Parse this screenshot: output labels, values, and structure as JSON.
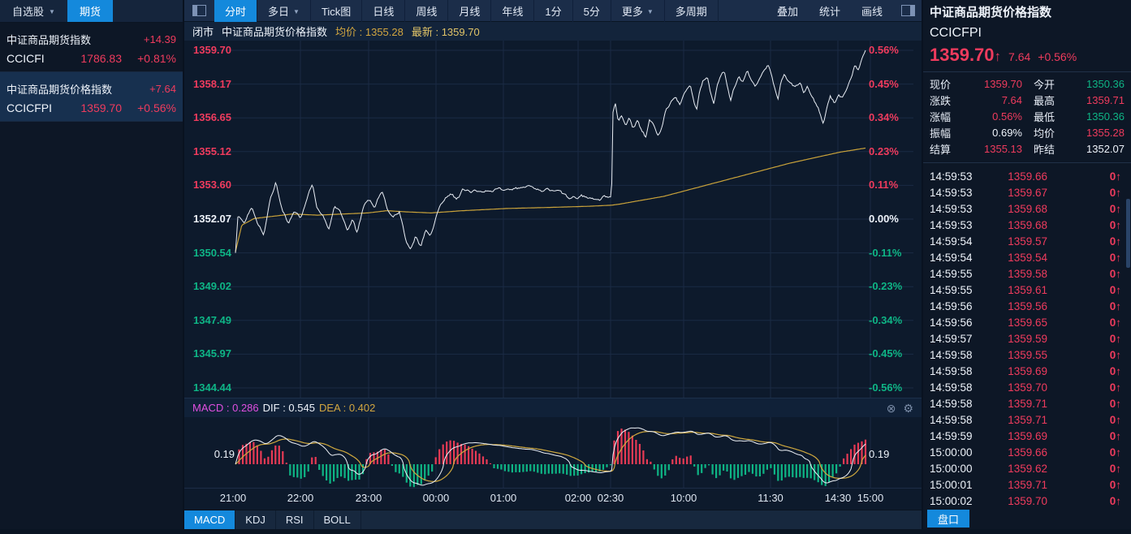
{
  "sidebar": {
    "tabs": [
      {
        "label": "自选股",
        "caret": true,
        "selected": false
      },
      {
        "label": "期货",
        "caret": false,
        "selected": true
      }
    ],
    "watchlist": [
      {
        "name": "中证商品期货指数",
        "code": "CCICFI",
        "price": "1786.83",
        "change": "+14.39",
        "pct": "+0.81%",
        "color": "red",
        "selected": false
      },
      {
        "name": "中证商品期货价格指数",
        "code": "CCICFPI",
        "price": "1359.70",
        "change": "+7.64",
        "pct": "+0.56%",
        "color": "red",
        "selected": true
      }
    ]
  },
  "toolbar": {
    "tabs": [
      {
        "label": "分时",
        "caret": false,
        "selected": true
      },
      {
        "label": "多日",
        "caret": true,
        "selected": false
      },
      {
        "label": "Tick图",
        "caret": false,
        "selected": false
      },
      {
        "label": "日线",
        "caret": false,
        "selected": false
      },
      {
        "label": "周线",
        "caret": false,
        "selected": false
      },
      {
        "label": "月线",
        "caret": false,
        "selected": false
      },
      {
        "label": "年线",
        "caret": false,
        "selected": false
      },
      {
        "label": "1分",
        "caret": false,
        "selected": false
      },
      {
        "label": "5分",
        "caret": false,
        "selected": false
      },
      {
        "label": "更多",
        "caret": true,
        "selected": false
      },
      {
        "label": "多周期",
        "caret": false,
        "selected": false
      }
    ],
    "right": [
      "叠加",
      "统计",
      "画线"
    ]
  },
  "chart_header": {
    "status": "闭市",
    "name": "中证商品期货价格指数",
    "avg": "均价 : 1355.28",
    "last": "最新 : 1359.70"
  },
  "macd_header": {
    "macd": "MACD : 0.286",
    "dif": "DIF : 0.545",
    "dea": "DEA : 0.402",
    "axis_label": "0.19"
  },
  "indicator_tabs": [
    {
      "label": "MACD",
      "selected": true
    },
    {
      "label": "KDJ",
      "selected": false
    },
    {
      "label": "RSI",
      "selected": false
    },
    {
      "label": "BOLL",
      "selected": false
    }
  ],
  "quote_panel": {
    "name": "中证商品期货价格指数",
    "code": "CCICFPI",
    "price": "1359.70",
    "arrow": "↑",
    "change": "7.64",
    "pct": "+0.56%",
    "stats": [
      {
        "label": "现价",
        "value": "1359.70",
        "color": "red"
      },
      {
        "label": "今开",
        "value": "1350.36",
        "color": "green"
      },
      {
        "label": "涨跌",
        "value": "7.64",
        "color": "red"
      },
      {
        "label": "最高",
        "value": "1359.71",
        "color": "red"
      },
      {
        "label": "涨幅",
        "value": "0.56%",
        "color": "red"
      },
      {
        "label": "最低",
        "value": "1350.36",
        "color": "green"
      },
      {
        "label": "振幅",
        "value": "0.69%",
        "color": "white"
      },
      {
        "label": "均价",
        "value": "1355.28",
        "color": "red"
      },
      {
        "label": "结算",
        "value": "1355.13",
        "color": "red"
      },
      {
        "label": "昨结",
        "value": "1352.07",
        "color": "white"
      }
    ],
    "ticks": [
      {
        "time": "14:59:53",
        "price": "1359.66",
        "vol": "0",
        "dir": "↑"
      },
      {
        "time": "14:59:53",
        "price": "1359.67",
        "vol": "0",
        "dir": "↑"
      },
      {
        "time": "14:59:53",
        "price": "1359.68",
        "vol": "0",
        "dir": "↑"
      },
      {
        "time": "14:59:53",
        "price": "1359.68",
        "vol": "0",
        "dir": "↑"
      },
      {
        "time": "14:59:54",
        "price": "1359.57",
        "vol": "0",
        "dir": "↑"
      },
      {
        "time": "14:59:54",
        "price": "1359.54",
        "vol": "0",
        "dir": "↑"
      },
      {
        "time": "14:59:55",
        "price": "1359.58",
        "vol": "0",
        "dir": "↑"
      },
      {
        "time": "14:59:55",
        "price": "1359.61",
        "vol": "0",
        "dir": "↑"
      },
      {
        "time": "14:59:56",
        "price": "1359.56",
        "vol": "0",
        "dir": "↑"
      },
      {
        "time": "14:59:56",
        "price": "1359.65",
        "vol": "0",
        "dir": "↑"
      },
      {
        "time": "14:59:57",
        "price": "1359.59",
        "vol": "0",
        "dir": "↑"
      },
      {
        "time": "14:59:58",
        "price": "1359.55",
        "vol": "0",
        "dir": "↑"
      },
      {
        "time": "14:59:58",
        "price": "1359.69",
        "vol": "0",
        "dir": "↑"
      },
      {
        "time": "14:59:58",
        "price": "1359.70",
        "vol": "0",
        "dir": "↑"
      },
      {
        "time": "14:59:58",
        "price": "1359.71",
        "vol": "0",
        "dir": "↑"
      },
      {
        "time": "14:59:58",
        "price": "1359.71",
        "vol": "0",
        "dir": "↑"
      },
      {
        "time": "14:59:59",
        "price": "1359.69",
        "vol": "0",
        "dir": "↑"
      },
      {
        "time": "15:00:00",
        "price": "1359.66",
        "vol": "0",
        "dir": "↑"
      },
      {
        "time": "15:00:00",
        "price": "1359.62",
        "vol": "0",
        "dir": "↑"
      },
      {
        "time": "15:00:01",
        "price": "1359.71",
        "vol": "0",
        "dir": "↑"
      },
      {
        "time": "15:00:02",
        "price": "1359.70",
        "vol": "0",
        "dir": "↑"
      }
    ],
    "pankou_label": "盘口"
  },
  "chart_data": {
    "type": "line",
    "title": "中证商品期货价格指数 分时",
    "y_axis": {
      "labels": [
        "1359.70",
        "1358.17",
        "1356.65",
        "1355.12",
        "1353.60",
        "1352.07",
        "1350.54",
        "1349.02",
        "1347.49",
        "1345.97",
        "1344.44"
      ],
      "top_value": 1359.7,
      "bottom_value": 1344.44,
      "prev_close": 1352.07
    },
    "pct_axis": {
      "labels": [
        "0.56%",
        "0.45%",
        "0.34%",
        "0.23%",
        "0.11%",
        "0.00%",
        "-0.11%",
        "-0.23%",
        "-0.34%",
        "-0.45%",
        "-0.56%"
      ]
    },
    "x_axis": {
      "labels": [
        "21:00",
        "22:00",
        "23:00",
        "00:00",
        "01:00",
        "02:00",
        "02:30",
        "10:00",
        "11:30",
        "14:30",
        "15:00"
      ],
      "positions": [
        60,
        143,
        227,
        310,
        393,
        485,
        525,
        615,
        722,
        805,
        845
      ]
    },
    "series": [
      {
        "name": "price",
        "color": "#e9eef5",
        "keypoints": [
          [
            0,
            1350.54
          ],
          [
            0.004,
            1352.2
          ],
          [
            0.013,
            1351.9
          ],
          [
            0.026,
            1352.6
          ],
          [
            0.036,
            1351.8
          ],
          [
            0.045,
            1351.3
          ],
          [
            0.055,
            1352.9
          ],
          [
            0.064,
            1353.7
          ],
          [
            0.075,
            1352.4
          ],
          [
            0.084,
            1351.9
          ],
          [
            0.093,
            1352.5
          ],
          [
            0.103,
            1352.0
          ],
          [
            0.113,
            1353.0
          ],
          [
            0.122,
            1353.6
          ],
          [
            0.129,
            1352.6
          ],
          [
            0.139,
            1352.2
          ],
          [
            0.148,
            1351.6
          ],
          [
            0.157,
            1352.7
          ],
          [
            0.168,
            1352.3
          ],
          [
            0.178,
            1351.5
          ],
          [
            0.186,
            1352.1
          ],
          [
            0.193,
            1351.4
          ],
          [
            0.202,
            1352.5
          ],
          [
            0.211,
            1353.0
          ],
          [
            0.222,
            1352.6
          ],
          [
            0.232,
            1353.4
          ],
          [
            0.241,
            1352.6
          ],
          [
            0.25,
            1352.1
          ],
          [
            0.26,
            1352.5
          ],
          [
            0.271,
            1351.0
          ],
          [
            0.278,
            1350.7
          ],
          [
            0.286,
            1351.3
          ],
          [
            0.294,
            1350.8
          ],
          [
            0.302,
            1351.6
          ],
          [
            0.309,
            1351.2
          ],
          [
            0.32,
            1352.4
          ],
          [
            0.33,
            1352.9
          ],
          [
            0.34,
            1353.2
          ],
          [
            0.35,
            1353.0
          ],
          [
            0.361,
            1353.4
          ],
          [
            0.374,
            1353.3
          ],
          [
            0.389,
            1353.4
          ],
          [
            0.405,
            1353.3
          ],
          [
            0.42,
            1353.5
          ],
          [
            0.436,
            1353.4
          ],
          [
            0.451,
            1353.5
          ],
          [
            0.466,
            1353.6
          ],
          [
            0.482,
            1353.4
          ],
          [
            0.497,
            1353.4
          ],
          [
            0.515,
            1353.3
          ],
          [
            0.533,
            1353.0
          ],
          [
            0.549,
            1353.1
          ],
          [
            0.564,
            1353.0
          ],
          [
            0.58,
            1353.0
          ],
          [
            0.593,
            1353.1
          ],
          [
            0.597,
            1353.2
          ],
          [
            0.599,
            1356.9
          ],
          [
            0.603,
            1357.3
          ],
          [
            0.608,
            1356.5
          ],
          [
            0.613,
            1356.7
          ],
          [
            0.619,
            1356.3
          ],
          [
            0.625,
            1356.6
          ],
          [
            0.631,
            1356.2
          ],
          [
            0.638,
            1356.5
          ],
          [
            0.644,
            1356.1
          ],
          [
            0.651,
            1355.8
          ],
          [
            0.657,
            1356.5
          ],
          [
            0.664,
            1356.3
          ],
          [
            0.67,
            1355.9
          ],
          [
            0.677,
            1356.2
          ],
          [
            0.683,
            1357.1
          ],
          [
            0.691,
            1357.3
          ],
          [
            0.698,
            1357.6
          ],
          [
            0.706,
            1357.2
          ],
          [
            0.714,
            1357.9
          ],
          [
            0.722,
            1358.1
          ],
          [
            0.728,
            1357.3
          ],
          [
            0.732,
            1357.0
          ],
          [
            0.737,
            1357.9
          ],
          [
            0.742,
            1358.3
          ],
          [
            0.749,
            1358.5
          ],
          [
            0.754,
            1357.8
          ],
          [
            0.759,
            1357.2
          ],
          [
            0.764,
            1358.1
          ],
          [
            0.771,
            1358.6
          ],
          [
            0.776,
            1358.8
          ],
          [
            0.781,
            1358.1
          ],
          [
            0.786,
            1357.4
          ],
          [
            0.793,
            1358.1
          ],
          [
            0.799,
            1358.6
          ],
          [
            0.805,
            1358.3
          ],
          [
            0.812,
            1358.7
          ],
          [
            0.818,
            1358.4
          ],
          [
            0.825,
            1358.1
          ],
          [
            0.832,
            1358.4
          ],
          [
            0.839,
            1358.8
          ],
          [
            0.845,
            1359.1
          ],
          [
            0.851,
            1358.5
          ],
          [
            0.856,
            1357.9
          ],
          [
            0.861,
            1357.4
          ],
          [
            0.866,
            1358.3
          ],
          [
            0.871,
            1358.7
          ],
          [
            0.876,
            1358.3
          ],
          [
            0.883,
            1358.2
          ],
          [
            0.889,
            1358.0
          ],
          [
            0.896,
            1358.2
          ],
          [
            0.902,
            1357.8
          ],
          [
            0.908,
            1358.0
          ],
          [
            0.915,
            1357.6
          ],
          [
            0.921,
            1357.3
          ],
          [
            0.928,
            1356.8
          ],
          [
            0.933,
            1356.4
          ],
          [
            0.938,
            1357.0
          ],
          [
            0.944,
            1357.6
          ],
          [
            0.951,
            1357.3
          ],
          [
            0.957,
            1357.7
          ],
          [
            0.964,
            1357.5
          ],
          [
            0.97,
            1358.0
          ],
          [
            0.977,
            1358.5
          ],
          [
            0.983,
            1359.0
          ],
          [
            0.988,
            1358.8
          ],
          [
            0.994,
            1359.3
          ],
          [
            1,
            1359.7
          ]
        ]
      },
      {
        "name": "avg",
        "color": "#c9a23a",
        "keypoints": [
          [
            0,
            1350.6
          ],
          [
            0.01,
            1351.8
          ],
          [
            0.03,
            1352.1
          ],
          [
            0.06,
            1352.2
          ],
          [
            0.09,
            1352.3
          ],
          [
            0.13,
            1352.25
          ],
          [
            0.17,
            1352.3
          ],
          [
            0.21,
            1352.35
          ],
          [
            0.24,
            1352.45
          ],
          [
            0.27,
            1352.4
          ],
          [
            0.31,
            1352.35
          ],
          [
            0.36,
            1352.45
          ],
          [
            0.43,
            1352.55
          ],
          [
            0.5,
            1352.6
          ],
          [
            0.56,
            1352.65
          ],
          [
            0.597,
            1352.7
          ],
          [
            0.61,
            1352.75
          ],
          [
            0.64,
            1352.9
          ],
          [
            0.68,
            1353.1
          ],
          [
            0.72,
            1353.4
          ],
          [
            0.76,
            1353.7
          ],
          [
            0.8,
            1354.0
          ],
          [
            0.84,
            1354.3
          ],
          [
            0.88,
            1354.6
          ],
          [
            0.92,
            1354.85
          ],
          [
            0.96,
            1355.1
          ],
          [
            1,
            1355.28
          ]
        ]
      }
    ],
    "noise_seed": 42,
    "noise_amp": 0.13,
    "macd_colors": {
      "hist_pos": "#e83a55",
      "hist_neg": "#0eb585",
      "dif": "#eef2f8",
      "dea": "#cfa83e"
    }
  }
}
